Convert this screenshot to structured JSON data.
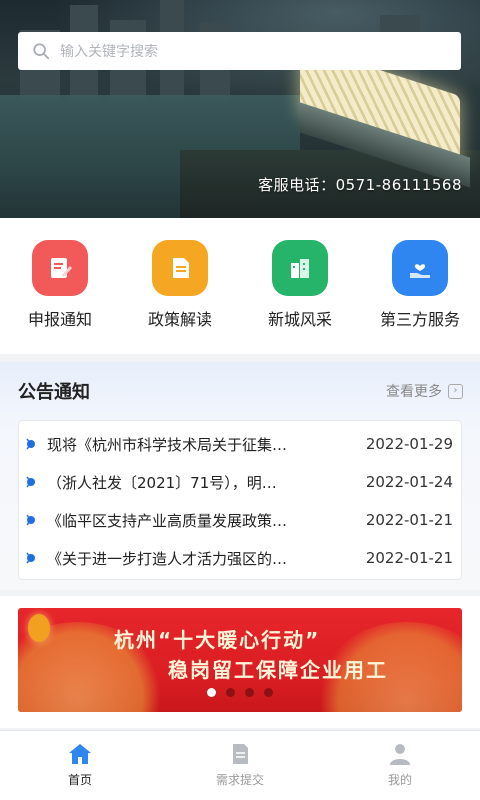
{
  "search": {
    "placeholder": "输入关键字搜索"
  },
  "hero": {
    "hotline": "客服电话：0571-86111568"
  },
  "quick_menu": [
    {
      "label": "申报通知",
      "icon": "notice-edit-icon",
      "color": "#f25a5a"
    },
    {
      "label": "政策解读",
      "icon": "document-icon",
      "color": "#f5a623"
    },
    {
      "label": "新城风采",
      "icon": "buildings-icon",
      "color": "#26b36a"
    },
    {
      "label": "第三方服务",
      "icon": "heart-hand-icon",
      "color": "#2f86f0"
    }
  ],
  "notice": {
    "title": "公告通知",
    "more": "查看更多",
    "items": [
      {
        "text": "现将《杭州市科学技术局关于征集…",
        "date": "2022-01-29"
      },
      {
        "text": "（浙人社发〔2021〕71号），明…",
        "date": "2022-01-24"
      },
      {
        "text": "《临平区支持产业高质量发展政策…",
        "date": "2022-01-21"
      },
      {
        "text": "《关于进一步打造人才活力强区的…",
        "date": "2022-01-21"
      }
    ]
  },
  "banner": {
    "line1": "杭州“十大暖心行动”",
    "line2": "稳岗留工保障企业用工",
    "slide_count": 4,
    "active_slide": 1
  },
  "tabs": [
    {
      "label": "首页",
      "icon": "home-icon",
      "active": true
    },
    {
      "label": "需求提交",
      "icon": "form-icon",
      "active": false
    },
    {
      "label": "我的",
      "icon": "user-icon",
      "active": false
    }
  ],
  "colors": {
    "accent": "#2f86f0",
    "bullet": "#1e6fe0",
    "tab_inactive": "#b8bcc2"
  }
}
